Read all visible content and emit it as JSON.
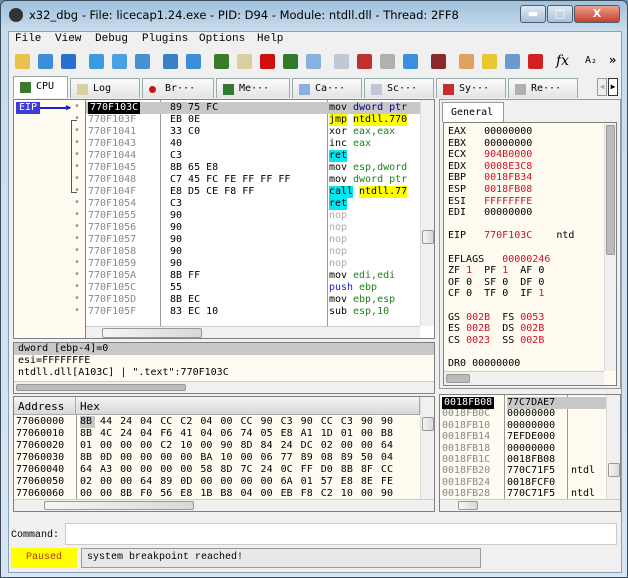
{
  "window": {
    "title": "x32_dbg - File: licecap1.24.exe - PID: D94 - Module: ntdll.dll - Thread: 2FF8",
    "minimize": "▬",
    "maximize": "□",
    "close": "X"
  },
  "menu": [
    "File",
    "View",
    "Debug",
    "Plugins",
    "Options",
    "Help"
  ],
  "toolbar": {
    "icons": [
      [
        "open-icon",
        "#e8c24a"
      ],
      [
        "restart-icon",
        "#3a8fd8"
      ],
      [
        "stop-icon",
        "#2a6fd0"
      ],
      [
        "run-icon",
        "#3a9be0"
      ],
      [
        "pause-icon",
        "#4aa0e0"
      ],
      [
        "step-into-icon",
        "#4a90d0"
      ],
      [
        "step-over-icon",
        "#3a80c8"
      ],
      [
        "execute-till-return-icon",
        "#3a90d8"
      ],
      [
        "cpu-icon",
        "#3a7a2a"
      ],
      [
        "log-icon",
        "#d8d0a0"
      ],
      [
        "breakpoint-icon",
        "#d01010"
      ],
      [
        "memory-map-icon",
        "#2f7a2f"
      ],
      [
        "call-stack-icon",
        "#8ab0e0"
      ],
      [
        "script-icon",
        "#c0c8d8"
      ],
      [
        "symbols-icon",
        "#c03030"
      ],
      [
        "references-icon",
        "#b0b0b0"
      ],
      [
        "threads-icon",
        "#3a90e0"
      ],
      [
        "patch-icon",
        "#8a2a2a"
      ],
      [
        "comments-icon",
        "#e0a060"
      ],
      [
        "labels-icon",
        "#e8c830"
      ],
      [
        "bookmarks-icon",
        "#6a9ad0"
      ],
      [
        "functions-icon",
        "#d02020"
      ]
    ],
    "fx": "fx",
    "ascii": "A₂",
    "more": "»"
  },
  "tabs": [
    {
      "label": "CPU",
      "icon": "cpu-icon",
      "color": "#3a7a2a"
    },
    {
      "label": "Log",
      "icon": "log-icon",
      "color": "#d8d0a0"
    },
    {
      "label": "Br···",
      "icon": "breakpoint-icon",
      "color": "#d01010"
    },
    {
      "label": "Me···",
      "icon": "memory-icon",
      "color": "#2f7a2f"
    },
    {
      "label": "Ca···",
      "icon": "call-stack-icon",
      "color": "#8ab0e0"
    },
    {
      "label": "Sc···",
      "icon": "script-icon",
      "color": "#c0c8d8"
    },
    {
      "label": "Sy···",
      "icon": "symbols-icon",
      "color": "#c03030"
    },
    {
      "label": "Re···",
      "icon": "references-icon",
      "color": "#b0b0b0"
    }
  ],
  "disasm": {
    "eip_label": "EIP",
    "rows": [
      [
        "770F103C",
        "89 75 FC",
        "mov",
        "dword ptr",
        "",
        "#000080"
      ],
      [
        "770F103F",
        "EB 0E",
        "jmp",
        "ntdll.770",
        "jmp",
        ""
      ],
      [
        "770F1041",
        "33 C0",
        "xor",
        "eax,eax",
        "",
        ""
      ],
      [
        "770F1043",
        "40",
        "inc",
        "eax",
        "",
        ""
      ],
      [
        "770F1044",
        "C3",
        "ret",
        "",
        "ret",
        ""
      ],
      [
        "770F1045",
        "8B 65 E8",
        "mov",
        "esp,dword",
        "",
        ""
      ],
      [
        "770F1048",
        "C7 45 FC FE FF FF FF",
        "mov",
        "dword ptr",
        "",
        ""
      ],
      [
        "770F104F",
        "E8 D5 CE F8 FF",
        "call",
        "ntdll.77",
        "call",
        ""
      ],
      [
        "770F1054",
        "C3",
        "ret",
        "",
        "ret",
        ""
      ],
      [
        "770F1055",
        "90",
        "nop",
        "",
        "nop",
        ""
      ],
      [
        "770F1056",
        "90",
        "nop",
        "",
        "nop",
        ""
      ],
      [
        "770F1057",
        "90",
        "nop",
        "",
        "nop",
        ""
      ],
      [
        "770F1058",
        "90",
        "nop",
        "",
        "nop",
        ""
      ],
      [
        "770F1059",
        "90",
        "nop",
        "",
        "nop",
        ""
      ],
      [
        "770F105A",
        "8B FF",
        "mov",
        "edi,edi",
        "",
        ""
      ],
      [
        "770F105C",
        "55",
        "push",
        "ebp",
        "push",
        ""
      ],
      [
        "770F105D",
        "8B EC",
        "mov",
        "ebp,esp",
        "",
        ""
      ],
      [
        "770F105F",
        "83 EC 10",
        "sub",
        "esp,10",
        "",
        ""
      ]
    ]
  },
  "registers": {
    "tab": "General",
    "lines": [
      [
        [
          "EAX   ",
          0
        ],
        [
          "00000000",
          0
        ]
      ],
      [
        [
          "EBX   ",
          0
        ],
        [
          "00000000",
          0
        ]
      ],
      [
        [
          "ECX   ",
          0
        ],
        [
          "904B0000",
          1
        ]
      ],
      [
        [
          "EDX   ",
          0
        ],
        [
          "0008E3C8",
          1
        ]
      ],
      [
        [
          "EBP   ",
          0
        ],
        [
          "0018FB34",
          1
        ]
      ],
      [
        [
          "ESP   ",
          0
        ],
        [
          "0018FB08",
          1
        ]
      ],
      [
        [
          "ESI   ",
          0
        ],
        [
          "FFFFFFFE",
          1
        ]
      ],
      [
        [
          "EDI   ",
          0
        ],
        [
          "00000000",
          0
        ]
      ],
      [],
      [
        [
          "EIP   ",
          0
        ],
        [
          "770F103C",
          1
        ],
        [
          "    ntd",
          0
        ]
      ],
      [],
      [
        [
          "EFLAGS   ",
          0
        ],
        [
          "00000246",
          1
        ]
      ],
      [
        [
          "ZF ",
          0
        ],
        [
          "1",
          1
        ],
        [
          "  PF ",
          0
        ],
        [
          "1",
          1
        ],
        [
          "  AF ",
          0
        ],
        [
          "0",
          0
        ]
      ],
      [
        [
          "OF ",
          0
        ],
        [
          "0",
          0
        ],
        [
          "  SF ",
          0
        ],
        [
          "0",
          0
        ],
        [
          "  DF ",
          0
        ],
        [
          "0",
          0
        ]
      ],
      [
        [
          "CF ",
          0
        ],
        [
          "0",
          0
        ],
        [
          "  TF ",
          0
        ],
        [
          "0",
          0
        ],
        [
          "  IF ",
          0
        ],
        [
          "1",
          1
        ]
      ],
      [],
      [
        [
          "GS ",
          0
        ],
        [
          "002B",
          1
        ],
        [
          "  FS ",
          0
        ],
        [
          "0053",
          1
        ]
      ],
      [
        [
          "ES ",
          0
        ],
        [
          "002B",
          1
        ],
        [
          "  DS ",
          0
        ],
        [
          "002B",
          1
        ]
      ],
      [
        [
          "CS ",
          0
        ],
        [
          "0023",
          1
        ],
        [
          "  SS ",
          0
        ],
        [
          "002B",
          1
        ]
      ],
      [],
      [
        [
          "DR0 00000000",
          0
        ]
      ]
    ]
  },
  "info": [
    "dword [ebp-4]=0",
    "esi=FFFFFFFE",
    "ntdll.dll[A103C] | \".text\":770F103C"
  ],
  "dump": {
    "headers": [
      "Address",
      "Hex"
    ],
    "rows": [
      [
        "77060000",
        "8B 44 24 04 CC C2 04 00 CC 90 C3 90 CC C3 90 90"
      ],
      [
        "77060010",
        "8B 4C 24 04 F6 41 04 06 74 05 E8 A1 1D 01 00 B8"
      ],
      [
        "77060020",
        "01 00 00 00 C2 10 00 90 8D 84 24 DC 02 00 00 64"
      ],
      [
        "77060030",
        "8B 0D 00 00 00 00 BA 10 00 06 77 89 08 89 50 04"
      ],
      [
        "77060040",
        "64 A3 00 00 00 00 58 8D 7C 24 0C FF D0 8B 8F CC"
      ],
      [
        "77060050",
        "02 00 00 64 89 0D 00 00 00 00 6A 01 57 E8 8E FE"
      ],
      [
        "77060060",
        "00 00 8B F0 56 E8 1B B8 04 00 EB F8 C2 10 00 90"
      ]
    ]
  },
  "stack": {
    "rows": [
      [
        "0018FB08",
        "77C7DAE7",
        ""
      ],
      [
        "0018FB0C",
        "00000000",
        ""
      ],
      [
        "0018FB10",
        "00000000",
        ""
      ],
      [
        "0018FB14",
        "7EFDE000",
        ""
      ],
      [
        "0018FB18",
        "00000000",
        ""
      ],
      [
        "0018FB1C",
        "0018FB08",
        ""
      ],
      [
        "0018FB20",
        "770C71F5",
        "ntdl"
      ],
      [
        "0018FB24",
        "0018FCF0",
        ""
      ],
      [
        "0018FB28",
        "770C71F5",
        "ntdl"
      ]
    ]
  },
  "command": {
    "label": "Command:",
    "value": ""
  },
  "status": {
    "state": "Paused",
    "message": "system breakpoint reached!",
    "state_color": "#ffff00"
  }
}
